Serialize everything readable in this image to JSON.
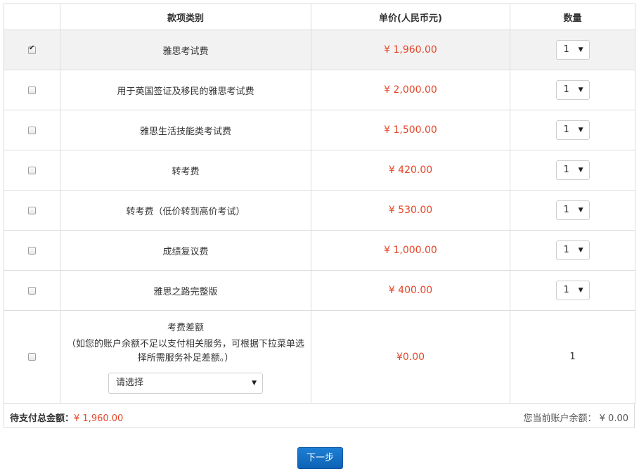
{
  "table": {
    "headers": {
      "category": "款项类别",
      "price": "单价(人民币元)",
      "quantity": "数量"
    },
    "rows": [
      {
        "name": "雅思考试费",
        "price": "¥ 1,960.00",
        "qty": "1",
        "checked": true
      },
      {
        "name": "用于英国签证及移民的雅思考试费",
        "price": "¥ 2,000.00",
        "qty": "1",
        "checked": false
      },
      {
        "name": "雅思生活技能类考试费",
        "price": "¥ 1,500.00",
        "qty": "1",
        "checked": false
      },
      {
        "name": "转考费",
        "price": "¥ 420.00",
        "qty": "1",
        "checked": false
      },
      {
        "name": "转考费（低价转到高价考试）",
        "price": "¥ 530.00",
        "qty": "1",
        "checked": false
      },
      {
        "name": "成绩复议费",
        "price": "¥ 1,000.00",
        "qty": "1",
        "checked": false
      },
      {
        "name": "雅思之路完整版",
        "price": "¥ 400.00",
        "qty": "1",
        "checked": false
      }
    ],
    "difference_row": {
      "title": "考费差额",
      "note": "（如您的账户余额不足以支付相关服务，可根据下拉菜单选择所需服务补足差额。）",
      "select_value": "请选择",
      "price": "¥0.00",
      "qty": "1"
    }
  },
  "summary": {
    "total_label": "待支付总金额：",
    "total_value": "¥ 1,960.00",
    "balance_label": "您当前账户余额：",
    "balance_value": "¥ 0.00"
  },
  "next_button": "下一步",
  "colors": {
    "price": "#e4462a",
    "button": "#1471c8"
  }
}
